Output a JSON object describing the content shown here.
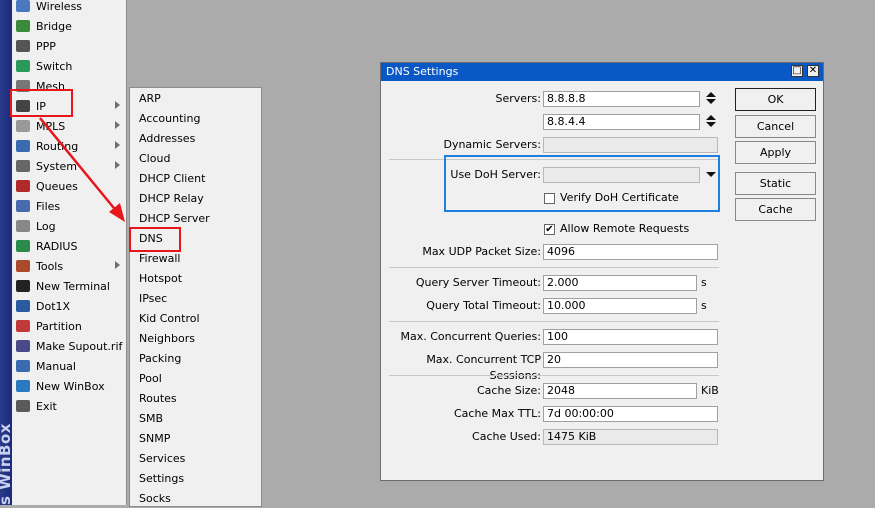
{
  "strip_label": "s WinBox",
  "main_menu": [
    {
      "label": "Wireless",
      "icon": "wireless-icon",
      "color": "#4a78c0",
      "submenu": false
    },
    {
      "label": "Bridge",
      "icon": "bridge-icon",
      "color": "#3a8a3a",
      "submenu": false
    },
    {
      "label": "PPP",
      "icon": "ppp-icon",
      "color": "#555555",
      "submenu": false
    },
    {
      "label": "Switch",
      "icon": "switch-icon",
      "color": "#2a9a5a",
      "submenu": false
    },
    {
      "label": "Mesh",
      "icon": "mesh-icon",
      "color": "#777777",
      "submenu": false
    },
    {
      "label": "IP",
      "icon": "ip-icon",
      "color": "#444444",
      "submenu": true
    },
    {
      "label": "MPLS",
      "icon": "mpls-icon",
      "color": "#999999",
      "submenu": true
    },
    {
      "label": "Routing",
      "icon": "routing-icon",
      "color": "#3a6ab0",
      "submenu": true
    },
    {
      "label": "System",
      "icon": "system-icon",
      "color": "#666666",
      "submenu": true
    },
    {
      "label": "Queues",
      "icon": "queues-icon",
      "color": "#b02a2a",
      "submenu": false
    },
    {
      "label": "Files",
      "icon": "files-icon",
      "color": "#4a6ab0",
      "submenu": false
    },
    {
      "label": "Log",
      "icon": "log-icon",
      "color": "#888888",
      "submenu": false
    },
    {
      "label": "RADIUS",
      "icon": "radius-icon",
      "color": "#2a8a4a",
      "submenu": false
    },
    {
      "label": "Tools",
      "icon": "tools-icon",
      "color": "#aa4a2a",
      "submenu": true
    },
    {
      "label": "New Terminal",
      "icon": "terminal-icon",
      "color": "#222222",
      "submenu": false
    },
    {
      "label": "Dot1X",
      "icon": "dot1x-icon",
      "color": "#2a5aa0",
      "submenu": false
    },
    {
      "label": "Partition",
      "icon": "partition-icon",
      "color": "#c03a3a",
      "submenu": false
    },
    {
      "label": "Make Supout.rif",
      "icon": "supout-icon",
      "color": "#4a4a8a",
      "submenu": false
    },
    {
      "label": "Manual",
      "icon": "manual-icon",
      "color": "#3a6ab0",
      "submenu": false
    },
    {
      "label": "New WinBox",
      "icon": "winbox-icon",
      "color": "#2a7ac0",
      "submenu": false
    },
    {
      "label": "Exit",
      "icon": "exit-icon",
      "color": "#5a5a5a",
      "submenu": false
    }
  ],
  "ip_submenu": [
    "ARP",
    "Accounting",
    "Addresses",
    "Cloud",
    "DHCP Client",
    "DHCP Relay",
    "DHCP Server",
    "DNS",
    "Firewall",
    "Hotspot",
    "IPsec",
    "Kid Control",
    "Neighbors",
    "Packing",
    "Pool",
    "Routes",
    "SMB",
    "SNMP",
    "Services",
    "Settings",
    "Socks"
  ],
  "dns": {
    "title": "DNS Settings",
    "servers_label": "Servers:",
    "servers": [
      "8.8.8.8",
      "8.8.4.4"
    ],
    "dynamic_servers_label": "Dynamic Servers:",
    "dynamic_servers": "",
    "use_doh_label": "Use DoH Server:",
    "use_doh_value": "",
    "verify_doh_label": "Verify DoH Certificate",
    "verify_doh_checked": false,
    "allow_remote_label": "Allow Remote Requests",
    "allow_remote_checked": true,
    "check_mark": "✔",
    "max_udp_label": "Max UDP Packet Size:",
    "max_udp": "4096",
    "query_server_timeout_label": "Query Server Timeout:",
    "query_server_timeout": "2.000",
    "query_total_timeout_label": "Query Total Timeout:",
    "query_total_timeout": "10.000",
    "seconds_unit": "s",
    "max_concurrent_queries_label": "Max. Concurrent Queries:",
    "max_concurrent_queries": "100",
    "max_concurrent_tcp_label": "Max. Concurrent TCP Sessions:",
    "max_concurrent_tcp": "20",
    "cache_size_label": "Cache Size:",
    "cache_size": "2048",
    "kib_unit": "KiB",
    "cache_max_ttl_label": "Cache Max TTL:",
    "cache_max_ttl": "7d 00:00:00",
    "cache_used_label": "Cache Used:",
    "cache_used": "1475 KiB",
    "buttons": {
      "ok": "OK",
      "cancel": "Cancel",
      "apply": "Apply",
      "static": "Static",
      "cache": "Cache"
    },
    "restore_glyph": "□",
    "close_glyph": "✕"
  },
  "colors": {
    "title_bar": "#0a58c6",
    "highlight_red": "#e8161b",
    "highlight_blue": "#1f7fe0"
  }
}
